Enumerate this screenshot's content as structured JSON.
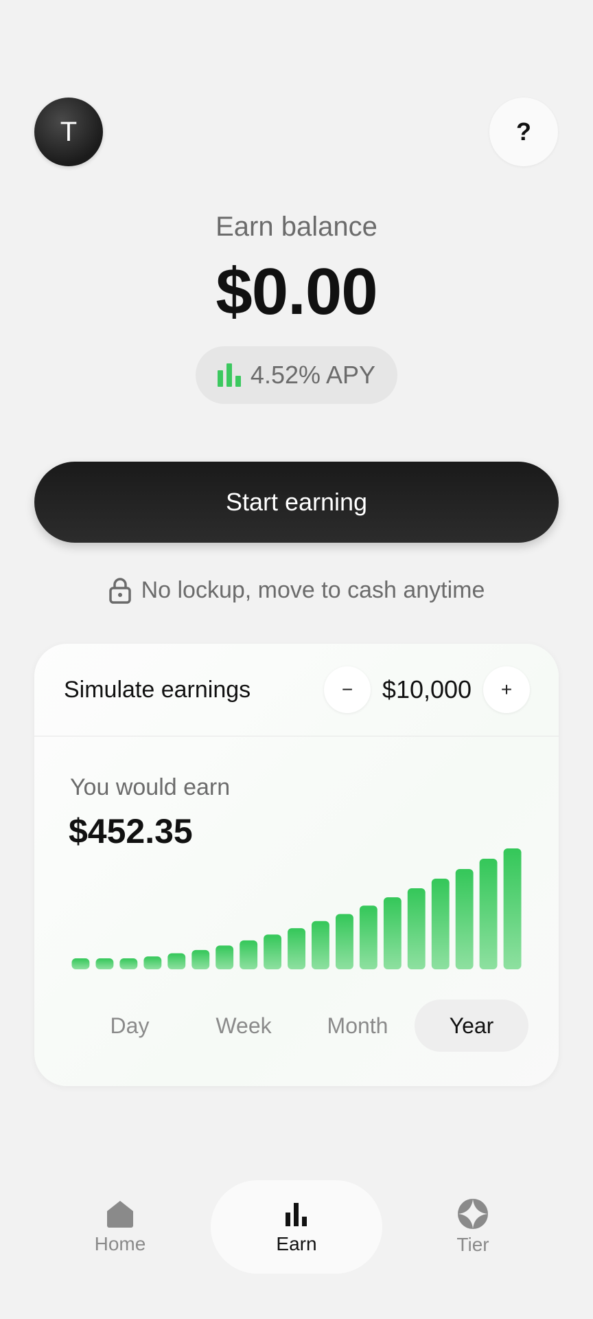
{
  "header": {
    "avatar_initial": "T",
    "help_label": "?"
  },
  "balance": {
    "label": "Earn balance",
    "value": "$0.00",
    "apy": "4.52% APY"
  },
  "cta": {
    "label": "Start earning"
  },
  "note": {
    "text": "No lockup, move to cash anytime"
  },
  "simulator": {
    "title": "Simulate earnings",
    "minus_label": "−",
    "plus_label": "+",
    "amount": "$10,000",
    "result_label": "You would earn",
    "result_value": "$452.35",
    "periods": [
      {
        "label": "Day",
        "active": false
      },
      {
        "label": "Week",
        "active": false
      },
      {
        "label": "Month",
        "active": false
      },
      {
        "label": "Year",
        "active": true
      }
    ]
  },
  "chart_data": {
    "type": "bar",
    "values": [
      1,
      1.3,
      1.6,
      2.0,
      2.5,
      3.0,
      3.7,
      4.5,
      5.4,
      6.4,
      7.5,
      8.6,
      9.9,
      11.2,
      12.6,
      14.1,
      15.6,
      17.2,
      18.8
    ],
    "ylim": [
      0,
      18.8
    ],
    "grid": false,
    "color": "#3cc85f"
  },
  "nav": {
    "items": [
      {
        "label": "Home",
        "icon": "home-icon",
        "active": false
      },
      {
        "label": "Earn",
        "icon": "bar-chart-icon",
        "active": true
      },
      {
        "label": "Tier",
        "icon": "tier-icon",
        "active": false
      }
    ]
  },
  "colors": {
    "accent": "#3cc85f",
    "background": "#f2f2f2",
    "cta": "#1a1a1a"
  }
}
